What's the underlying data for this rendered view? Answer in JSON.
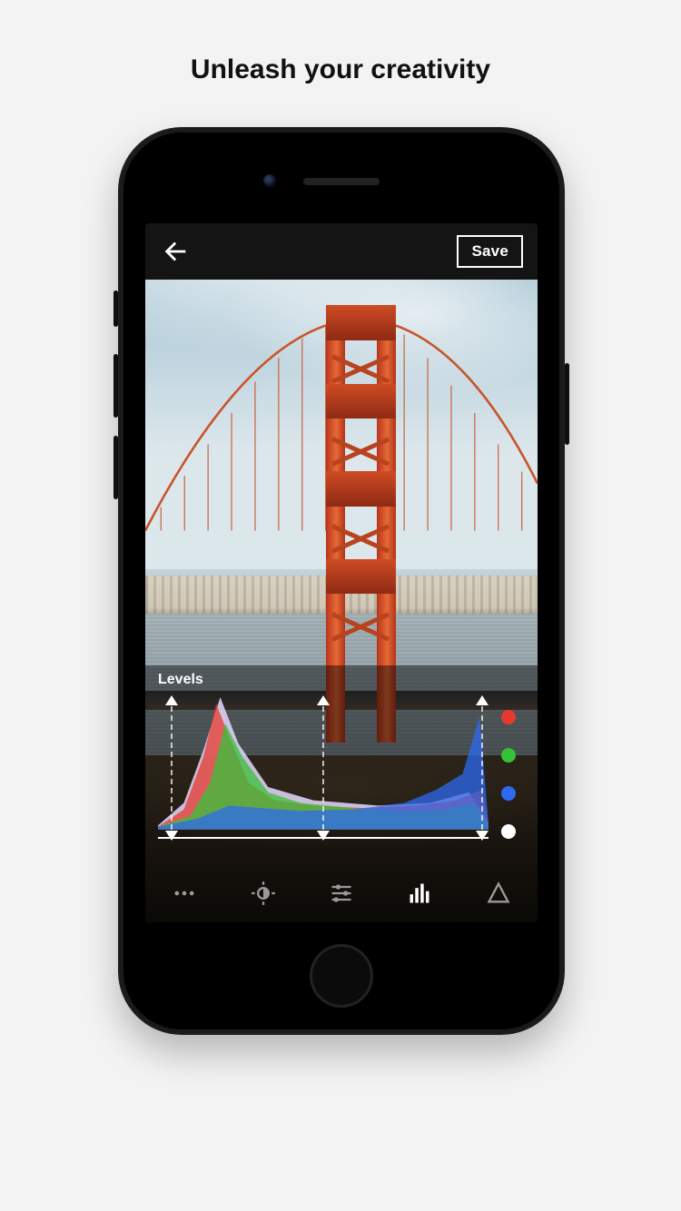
{
  "marketing_title": "Unleash your creativity",
  "appbar": {
    "save_label": "Save"
  },
  "panel": {
    "title": "Levels"
  },
  "levels": {
    "handles": {
      "shadows": 4,
      "midtones": 50,
      "highlights": 98
    }
  },
  "channels": [
    {
      "name": "red",
      "color": "#e53b2e",
      "selected": false
    },
    {
      "name": "green",
      "color": "#35c13a",
      "selected": false
    },
    {
      "name": "blue",
      "color": "#2e6af0",
      "selected": false
    },
    {
      "name": "luma",
      "color": "#ffffff",
      "selected": true
    }
  ],
  "toolbar": [
    {
      "name": "more",
      "semantic": "more-icon",
      "active": false
    },
    {
      "name": "light",
      "semantic": "exposure-icon",
      "active": false
    },
    {
      "name": "sliders",
      "semantic": "sliders-icon",
      "active": false
    },
    {
      "name": "levels",
      "semantic": "histogram-icon",
      "active": true
    },
    {
      "name": "sharpen",
      "semantic": "triangle-icon",
      "active": false
    }
  ],
  "chart_data": {
    "type": "area",
    "title": "Levels",
    "xlabel": "",
    "ylabel": "",
    "xlim": [
      0,
      255
    ],
    "ylim": [
      0,
      1
    ],
    "series": [
      {
        "name": "red",
        "color": "#e53b2e",
        "x": [
          0,
          20,
          35,
          45,
          55,
          70,
          90,
          120,
          160,
          200,
          230,
          250,
          255
        ],
        "y": [
          0.02,
          0.15,
          0.55,
          0.95,
          0.7,
          0.35,
          0.22,
          0.18,
          0.16,
          0.18,
          0.22,
          0.3,
          0.05
        ]
      },
      {
        "name": "green",
        "color": "#35c13a",
        "x": [
          0,
          25,
          40,
          52,
          65,
          85,
          110,
          150,
          190,
          220,
          245,
          255
        ],
        "y": [
          0.02,
          0.1,
          0.35,
          0.8,
          0.55,
          0.28,
          0.2,
          0.16,
          0.14,
          0.15,
          0.2,
          0.04
        ]
      },
      {
        "name": "blue",
        "color": "#2e6af0",
        "x": [
          0,
          30,
          55,
          80,
          110,
          150,
          190,
          215,
          235,
          248,
          255
        ],
        "y": [
          0.02,
          0.08,
          0.18,
          0.16,
          0.14,
          0.15,
          0.2,
          0.3,
          0.42,
          0.85,
          0.05
        ]
      },
      {
        "name": "luma",
        "color": "#e8d8ff",
        "x": [
          0,
          20,
          35,
          48,
          62,
          85,
          120,
          170,
          210,
          240,
          255
        ],
        "y": [
          0.03,
          0.2,
          0.6,
          1.0,
          0.65,
          0.32,
          0.22,
          0.18,
          0.2,
          0.28,
          0.05
        ]
      }
    ],
    "handles": {
      "shadows_pct": 4,
      "midtones_pct": 50,
      "highlights_pct": 98
    }
  }
}
